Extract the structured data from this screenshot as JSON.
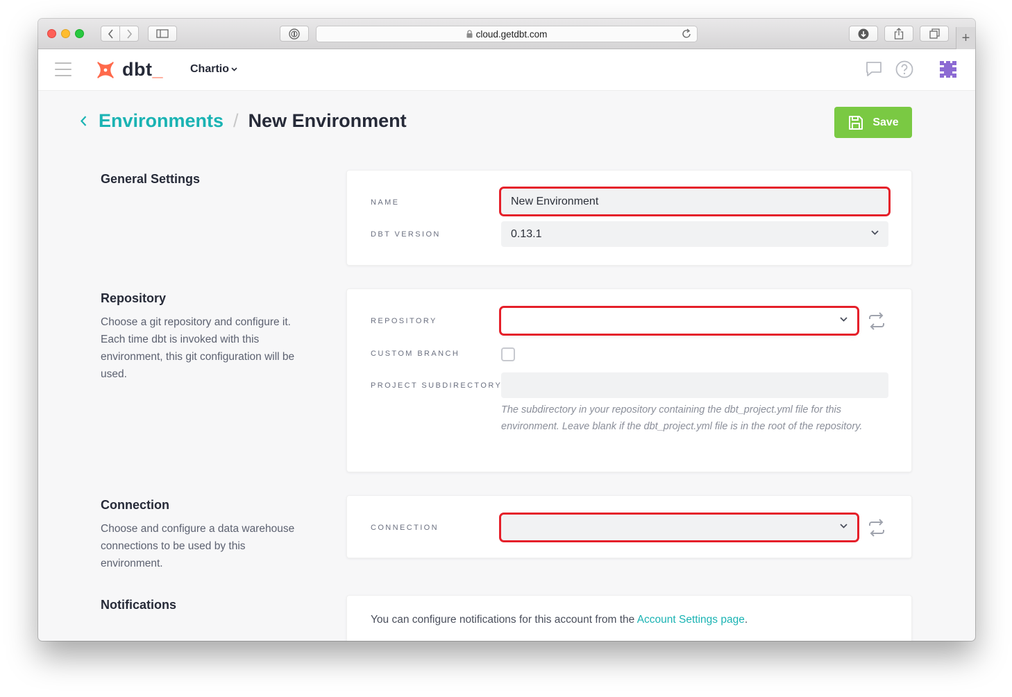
{
  "browser": {
    "url": "cloud.getdbt.com"
  },
  "header": {
    "logo_text": "dbt",
    "logo_underscore": "_",
    "org_name": "Chartio"
  },
  "breadcrumb": {
    "parent": "Environments",
    "separator": "/",
    "current": "New Environment"
  },
  "toolbar": {
    "save_label": "Save"
  },
  "general": {
    "title": "General Settings",
    "name_label": "NAME",
    "name_value": "New Environment",
    "version_label": "DBT VERSION",
    "version_value": "0.13.1"
  },
  "repository": {
    "title": "Repository",
    "description": "Choose a git repository and configure it. Each time dbt is invoked with this environment, this git configuration will be used.",
    "repository_label": "REPOSITORY",
    "repository_value": "",
    "custom_branch_label": "CUSTOM BRANCH",
    "subdirectory_label": "PROJECT SUBDIRECTORY",
    "subdirectory_value": "",
    "subdirectory_help": "The subdirectory in your repository containing the dbt_project.yml file for this environment. Leave blank if the dbt_project.yml file is in the root of the repository."
  },
  "connection": {
    "title": "Connection",
    "description": "Choose and configure a data warehouse connections to be used by this environment.",
    "connection_label": "CONNECTION",
    "connection_value": ""
  },
  "notifications": {
    "title": "Notifications",
    "text": "You can configure notifications for this account from the",
    "link": "Account Settings page",
    "suffix": "."
  },
  "colors": {
    "accent": "#1ab3b3",
    "save_green": "#7ac943",
    "highlight_red": "#e5202a",
    "logo_orange": "#ff694b"
  },
  "icons": {
    "back": "chevron-left-icon",
    "save": "floppy-disk-icon",
    "sync": "refresh-arrows-icon",
    "chat": "chat-bubble-icon",
    "help": "question-circle-icon",
    "avatar": "identicon-avatar"
  }
}
